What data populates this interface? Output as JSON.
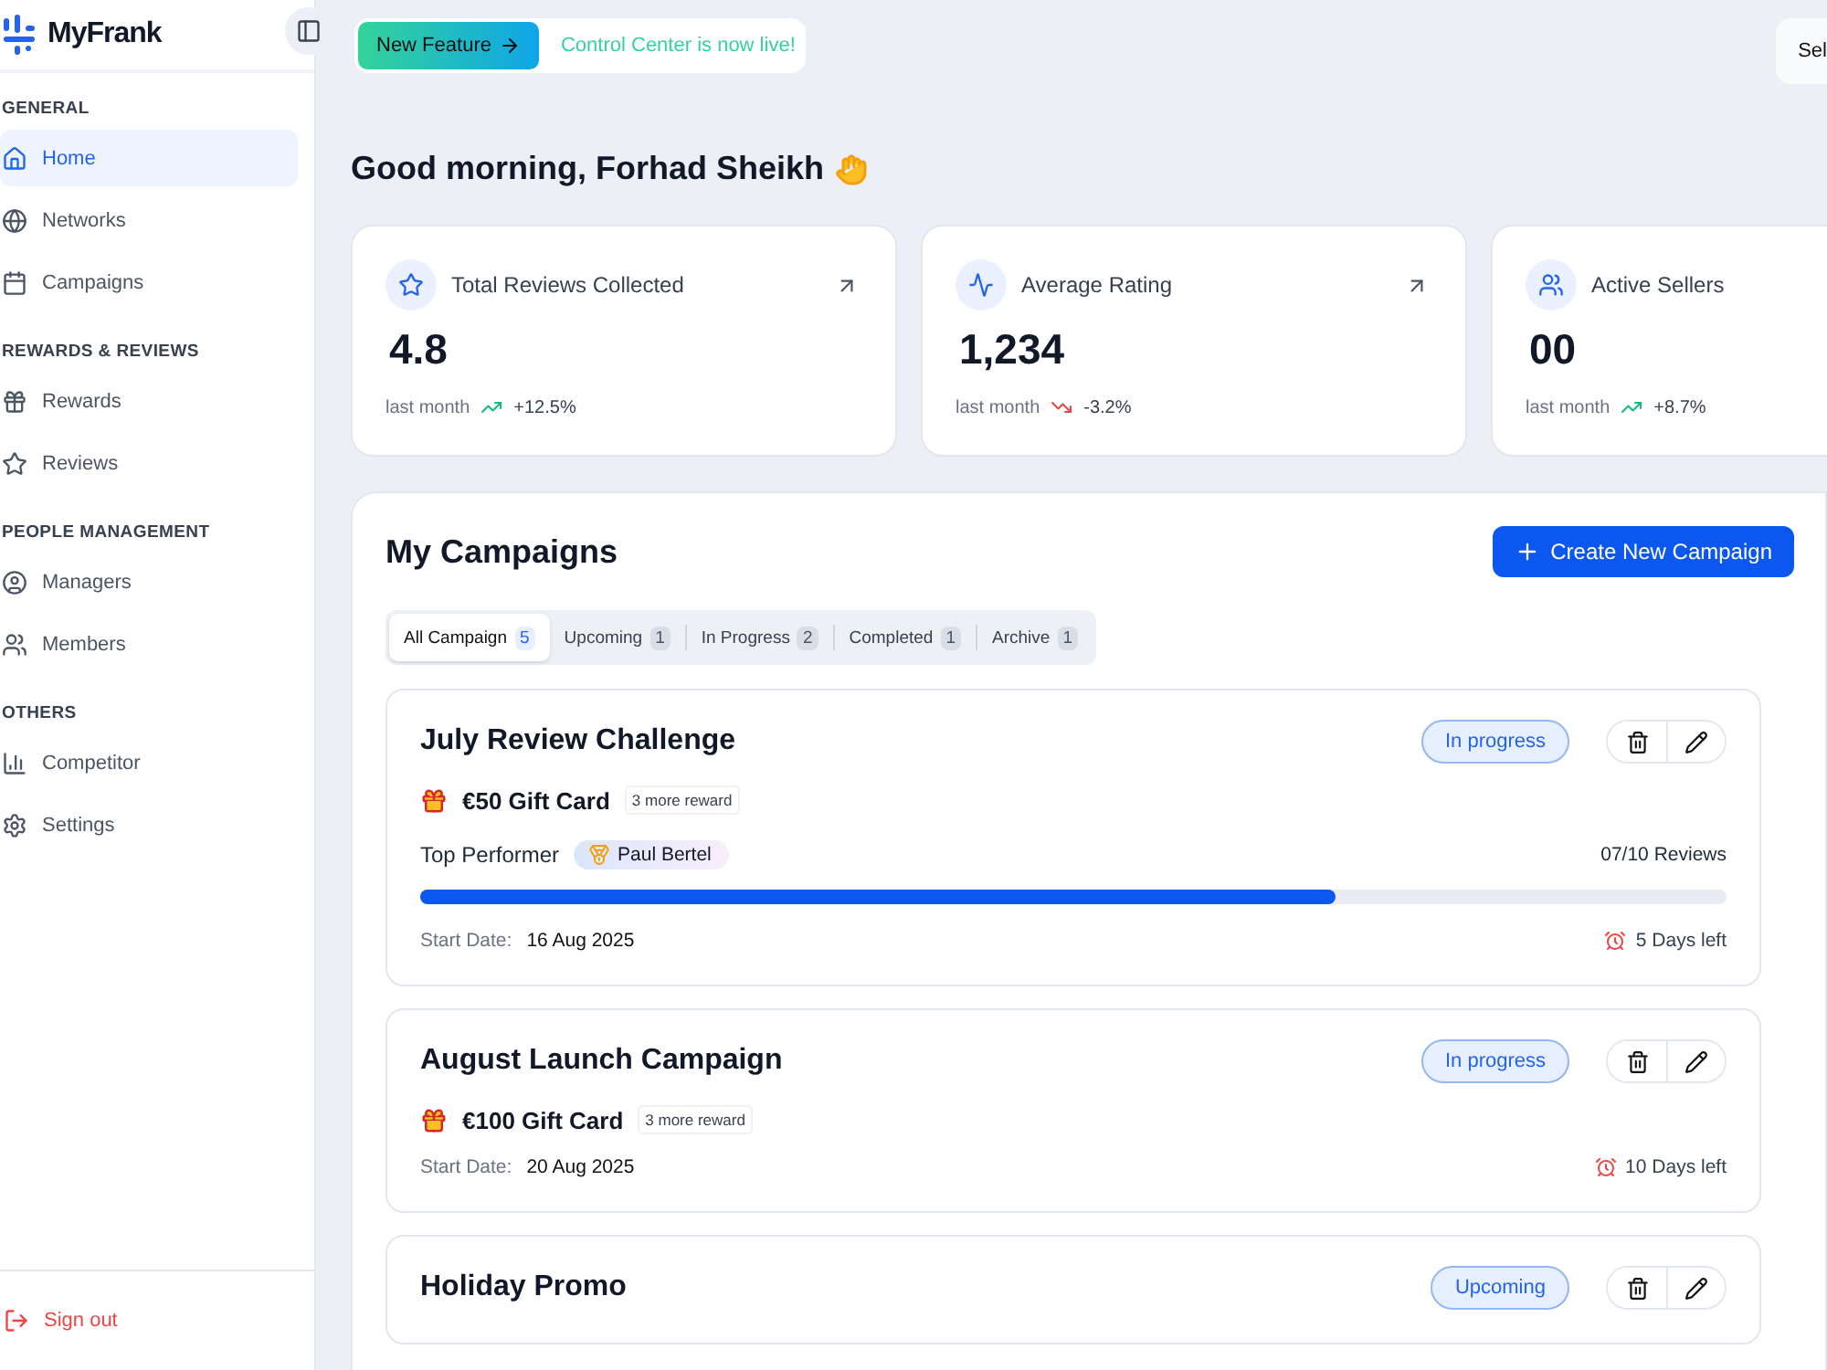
{
  "sidebar": {
    "brand": "MyFrank",
    "sections": [
      {
        "title": "GENERAL",
        "items": [
          {
            "label": "Home",
            "selected": true
          },
          {
            "label": "Networks",
            "selected": false
          },
          {
            "label": "Campaigns",
            "selected": false
          }
        ]
      },
      {
        "title": "REWARDS & REVIEWS",
        "items": [
          {
            "label": "Rewards",
            "selected": false
          },
          {
            "label": "Reviews",
            "selected": false
          }
        ]
      },
      {
        "title": "PEOPLE MANAGEMENT",
        "items": [
          {
            "label": "Managers",
            "selected": false
          },
          {
            "label": "Members",
            "selected": false
          }
        ]
      },
      {
        "title": "OTHERS",
        "items": [
          {
            "label": "Competitor",
            "selected": false
          },
          {
            "label": "Settings",
            "selected": false
          }
        ]
      }
    ],
    "sign_out": "Sign out"
  },
  "banner": {
    "badge": "New Feature",
    "message": "Control Center is now live!"
  },
  "top_button": "Sel",
  "greeting": "Good morning, Forhad Sheikh",
  "stats": [
    {
      "title": "Total Reviews Collected",
      "value": "4.8",
      "period": "last month",
      "change": "+12.5%",
      "rising": true,
      "link": true
    },
    {
      "title": "Average Rating",
      "value": "1,234",
      "period": "last month",
      "change": "-3.2%",
      "rising": false,
      "link": true
    },
    {
      "title": "Active Sellers",
      "value": "00",
      "period": "last month",
      "change": "+8.7%",
      "rising": true,
      "link": false
    }
  ],
  "campaigns": {
    "title": "My Campaigns",
    "create_button": "Create New Campaign",
    "tabs": [
      {
        "label": "All Campaign",
        "count": "5",
        "selected": true
      },
      {
        "label": "Upcoming",
        "count": "1",
        "selected": false
      },
      {
        "label": "In Progress",
        "count": "2",
        "selected": false
      },
      {
        "label": "Completed",
        "count": "1",
        "selected": false
      },
      {
        "label": "Archive",
        "count": "1",
        "selected": false
      }
    ],
    "items": [
      {
        "name": "July Review Challenge",
        "status": "In progress",
        "reward": "€50 Gift Card",
        "more": "3 more reward",
        "top_label": "Top Performer",
        "top_name": "Paul Bertel",
        "reviews": "07/10 Reviews",
        "level": 0.7,
        "date_label": "Start Date:",
        "date": "16 Aug 2025",
        "left": "5 Days left"
      },
      {
        "name": "August Launch Campaign",
        "status": "In progress",
        "reward": "€100 Gift Card",
        "more": "3 more reward",
        "date_label": "Start Date:",
        "date": "20 Aug 2025",
        "left": "10 Days left"
      },
      {
        "name": "Holiday Promo",
        "status": "Upcoming"
      }
    ]
  }
}
